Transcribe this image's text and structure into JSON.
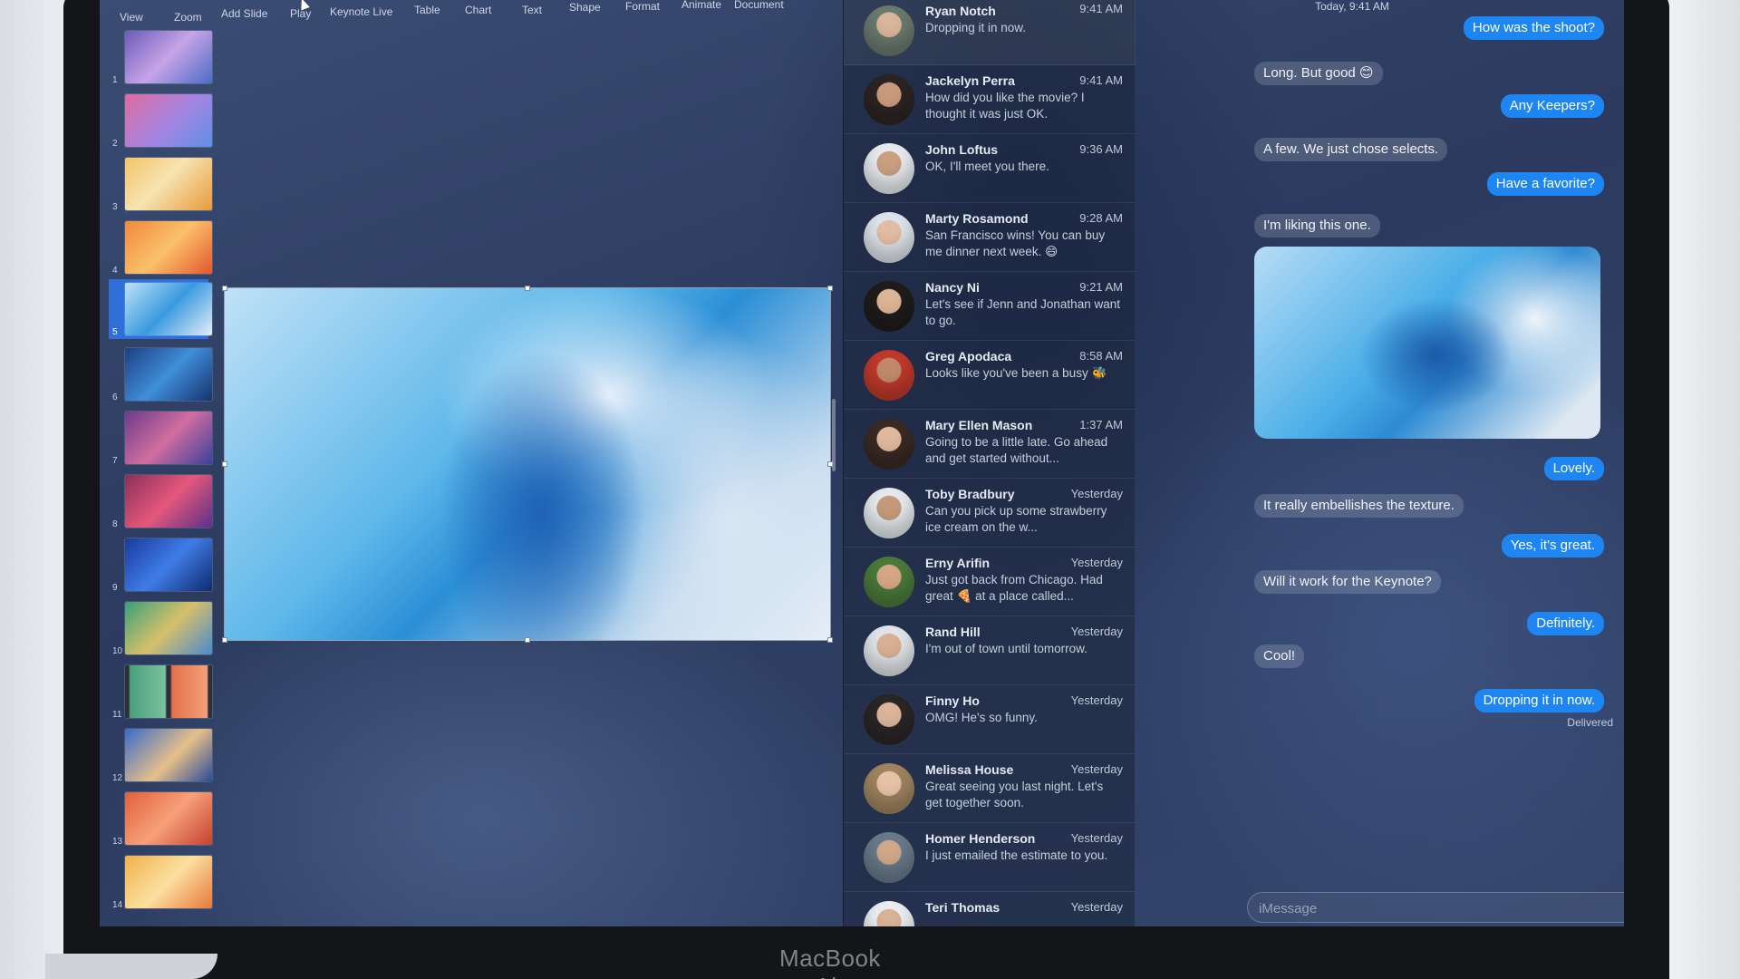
{
  "keynote": {
    "toolbar": [
      "View",
      "Zoom",
      "Add Slide",
      "Play",
      "Keynote Live",
      "Table",
      "Chart",
      "Text",
      "Shape",
      "Format",
      "Animate",
      "Document"
    ],
    "slides": [
      "1",
      "2",
      "3",
      "4",
      "5",
      "6",
      "7",
      "8",
      "9",
      "10",
      "11",
      "12",
      "13",
      "14"
    ],
    "selected_slide": "5"
  },
  "conversations": [
    {
      "name": "Ryan Notch",
      "time": "9:41 AM",
      "preview": "Dropping it in now."
    },
    {
      "name": "Jackelyn Perra",
      "time": "9:41 AM",
      "preview": "How did you like the movie? I thought it was just OK."
    },
    {
      "name": "John Loftus",
      "time": "9:36 AM",
      "preview": "OK, I'll meet you there."
    },
    {
      "name": "Marty Rosamond",
      "time": "9:28 AM",
      "preview": "San Francisco wins! You can buy me dinner next week. 😄"
    },
    {
      "name": "Nancy Ni",
      "time": "9:21 AM",
      "preview": "Let's see if Jenn and Jonathan want to go."
    },
    {
      "name": "Greg Apodaca",
      "time": "8:58 AM",
      "preview": "Looks like you've been a busy 🐝"
    },
    {
      "name": "Mary Ellen Mason",
      "time": "1:37 AM",
      "preview": "Going to be a little late. Go ahead and get started without..."
    },
    {
      "name": "Toby Bradbury",
      "time": "Yesterday",
      "preview": "Can you pick up some strawberry ice cream on the w..."
    },
    {
      "name": "Erny Arifin",
      "time": "Yesterday",
      "preview": "Just got back from Chicago. Had great 🍕 at a place called..."
    },
    {
      "name": "Rand Hill",
      "time": "Yesterday",
      "preview": "I'm out of town until tomorrow."
    },
    {
      "name": "Finny Ho",
      "time": "Yesterday",
      "preview": "OMG! He's so funny."
    },
    {
      "name": "Melissa House",
      "time": "Yesterday",
      "preview": "Great seeing you last night. Let's get together soon."
    },
    {
      "name": "Homer Henderson",
      "time": "Yesterday",
      "preview": "I just emailed the estimate to you."
    },
    {
      "name": "Teri Thomas",
      "time": "Yesterday",
      "preview": ""
    }
  ],
  "chat": {
    "date": "Today, 9:41 AM",
    "messages": [
      {
        "dir": "out",
        "text": "How was the shoot?"
      },
      {
        "dir": "in",
        "text": "Long. But good 😊"
      },
      {
        "dir": "out",
        "text": "Any Keepers?"
      },
      {
        "dir": "in",
        "text": "A few. We just chose selects."
      },
      {
        "dir": "out",
        "text": "Have a favorite?"
      },
      {
        "dir": "in",
        "text": "I'm liking this one."
      },
      {
        "dir": "out",
        "text": "Lovely."
      },
      {
        "dir": "in",
        "text": "It really embellishes the texture."
      },
      {
        "dir": "out",
        "text": "Yes, it's great."
      },
      {
        "dir": "in",
        "text": "Will it work for the Keynote?"
      },
      {
        "dir": "out",
        "text": "Definitely."
      },
      {
        "dir": "in",
        "text": "Cool!"
      },
      {
        "dir": "out",
        "text": "Dropping it in now."
      }
    ],
    "status": "Delivered",
    "input_placeholder": "iMessage",
    "emoji_glyph": "☺"
  },
  "device_label": "MacBook Air",
  "colors": {
    "accent": "#1e86f3",
    "selection": "#2e6fd8"
  }
}
